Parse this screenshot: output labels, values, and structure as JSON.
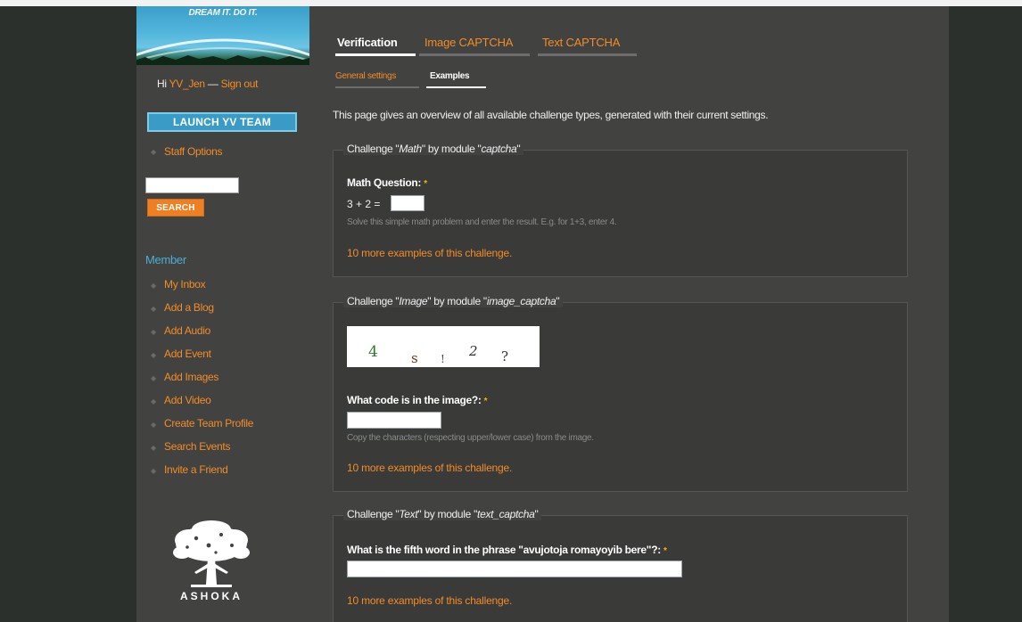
{
  "banner": {
    "tagline": "DREAM IT. DO IT."
  },
  "sidebar": {
    "greeting_prefix": "Hi ",
    "username": "YV_Jen",
    "separator": " — ",
    "signout": "Sign out",
    "launch_button": "LAUNCH YV TEAM",
    "staff_options": "Staff Options",
    "search_placeholder": "",
    "search_button": "SEARCH",
    "member_heading": "Member",
    "member_items": [
      {
        "label": "My Inbox"
      },
      {
        "label": "Add a Blog"
      },
      {
        "label": "Add Audio"
      },
      {
        "label": "Add Event"
      },
      {
        "label": "Add Images"
      },
      {
        "label": "Add Video"
      },
      {
        "label": "Create Team Profile"
      },
      {
        "label": "Search Events"
      },
      {
        "label": "Invite a Friend"
      }
    ],
    "logo_text": "ASHOKA"
  },
  "tabs": {
    "primary": [
      {
        "label": "Verification",
        "active": true
      },
      {
        "label": "Image CAPTCHA",
        "active": false
      },
      {
        "label": "Text CAPTCHA",
        "active": false
      }
    ],
    "secondary": [
      {
        "label": "General settings",
        "active": false
      },
      {
        "label": "Examples",
        "active": true
      }
    ]
  },
  "intro": "This page gives an overview of all available challenge types, generated with their current settings.",
  "challenges": [
    {
      "legend_prefix": "Challenge \"",
      "type": "Math",
      "legend_middle": "\" by module \"",
      "module": "captcha",
      "legend_suffix": "\"",
      "label": "Math Question:",
      "required_mark": "*",
      "question": "3 + 2 =",
      "description": "Solve this simple math problem and enter the result. E.g. for 1+3, enter 4.",
      "more_link": "10 more examples of this challenge."
    },
    {
      "legend_prefix": "Challenge \"",
      "type": "Image",
      "legend_middle": "\" by module \"",
      "module": "image_captcha",
      "legend_suffix": "\"",
      "captcha_chars": [
        "4",
        "s",
        "!",
        "2",
        "?"
      ],
      "label": "What code is in the image?:",
      "required_mark": "*",
      "description": "Copy the characters (respecting upper/lower case) from the image.",
      "more_link": "10 more examples of this challenge."
    },
    {
      "legend_prefix": "Challenge \"",
      "type": "Text",
      "legend_middle": "\" by module \"",
      "module": "text_captcha",
      "legend_suffix": "\"",
      "label": "What is the fifth word in the phrase \"avujotoja romayoyib bere\"?:",
      "required_mark": "*",
      "more_link": "10 more examples of this challenge."
    }
  ],
  "colors": {
    "accent": "#f28c28",
    "link_blue": "#4aaed5",
    "launch_button": "#3a9cc6",
    "search_button": "#ee7f22",
    "panel": "#424241",
    "fieldset": "#3a3a39"
  }
}
